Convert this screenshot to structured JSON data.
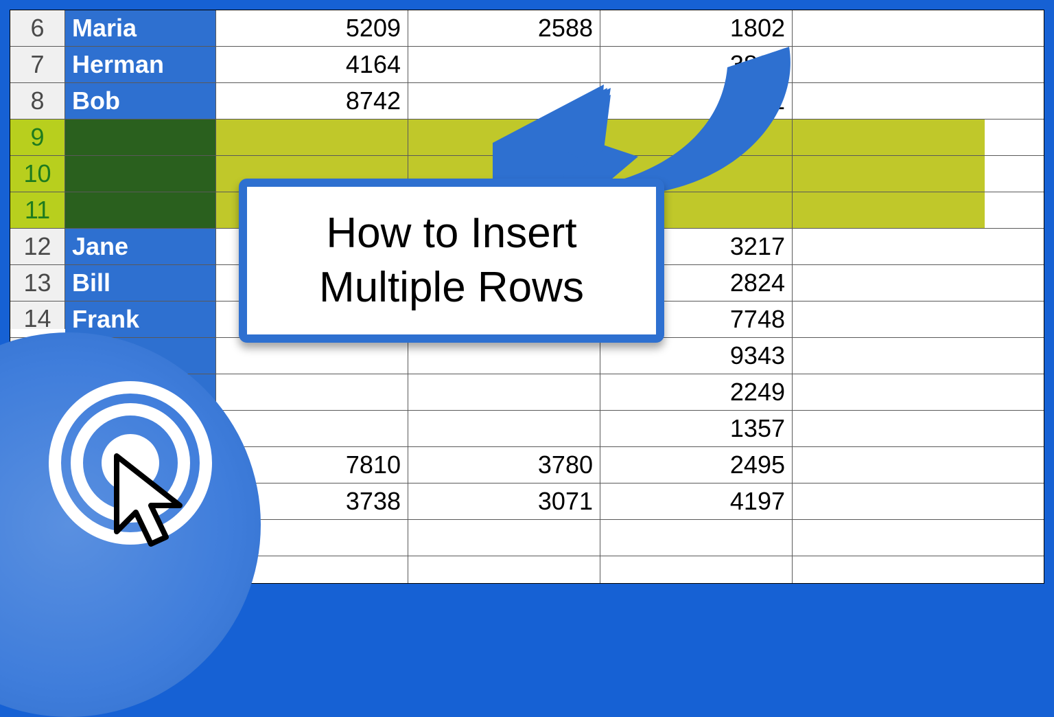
{
  "title_box": "How to Insert Multiple Rows",
  "chart_data": {
    "type": "table",
    "columns": [
      "row_number",
      "name",
      "col_b",
      "col_c",
      "col_d"
    ],
    "rows": [
      {
        "row_number": "6",
        "name": "Maria",
        "col_b": "5209",
        "col_c": "2588",
        "col_d": "1802",
        "selected": false
      },
      {
        "row_number": "7",
        "name": "Herman",
        "col_b": "4164",
        "col_c": "",
        "col_d": "3807",
        "selected": false
      },
      {
        "row_number": "8",
        "name": "Bob",
        "col_b": "8742",
        "col_c": "",
        "col_d": "6841",
        "selected": false
      },
      {
        "row_number": "9",
        "name": "",
        "col_b": "",
        "col_c": "",
        "col_d": "",
        "selected": true
      },
      {
        "row_number": "10",
        "name": "",
        "col_b": "",
        "col_c": "",
        "col_d": "",
        "selected": true
      },
      {
        "row_number": "11",
        "name": "",
        "col_b": "",
        "col_c": "",
        "col_d": "",
        "selected": true
      },
      {
        "row_number": "12",
        "name": "Jane",
        "col_b": "",
        "col_c": "",
        "col_d": "3217",
        "selected": false
      },
      {
        "row_number": "13",
        "name": "Bill",
        "col_b": "",
        "col_c": "",
        "col_d": "2824",
        "selected": false
      },
      {
        "row_number": "14",
        "name": "Frank",
        "col_b": "",
        "col_c": "",
        "col_d": "7748",
        "selected": false
      },
      {
        "row_number": "",
        "name": "",
        "col_b": "",
        "col_c": "",
        "col_d": "9343",
        "selected": false
      },
      {
        "row_number": "",
        "name": "",
        "col_b": "",
        "col_c": "",
        "col_d": "2249",
        "selected": false
      },
      {
        "row_number": "",
        "name": "",
        "col_b": "",
        "col_c": "",
        "col_d": "1357",
        "selected": false
      },
      {
        "row_number": "",
        "name": "",
        "col_b": "7810",
        "col_c": "3780",
        "col_d": "2495",
        "selected": false
      },
      {
        "row_number": "",
        "name": "",
        "col_b": "3738",
        "col_c": "3071",
        "col_d": "4197",
        "selected": false
      }
    ]
  },
  "colors": {
    "frame": "#1661d4",
    "header_bg": "#f0f0f0",
    "name_col_bg": "#2e70d0",
    "selected_row_bg": "#c0c82a",
    "selected_header_bg": "#b8cf1e",
    "selected_name_bg": "#2a601e",
    "arrow": "#2e70d0"
  }
}
